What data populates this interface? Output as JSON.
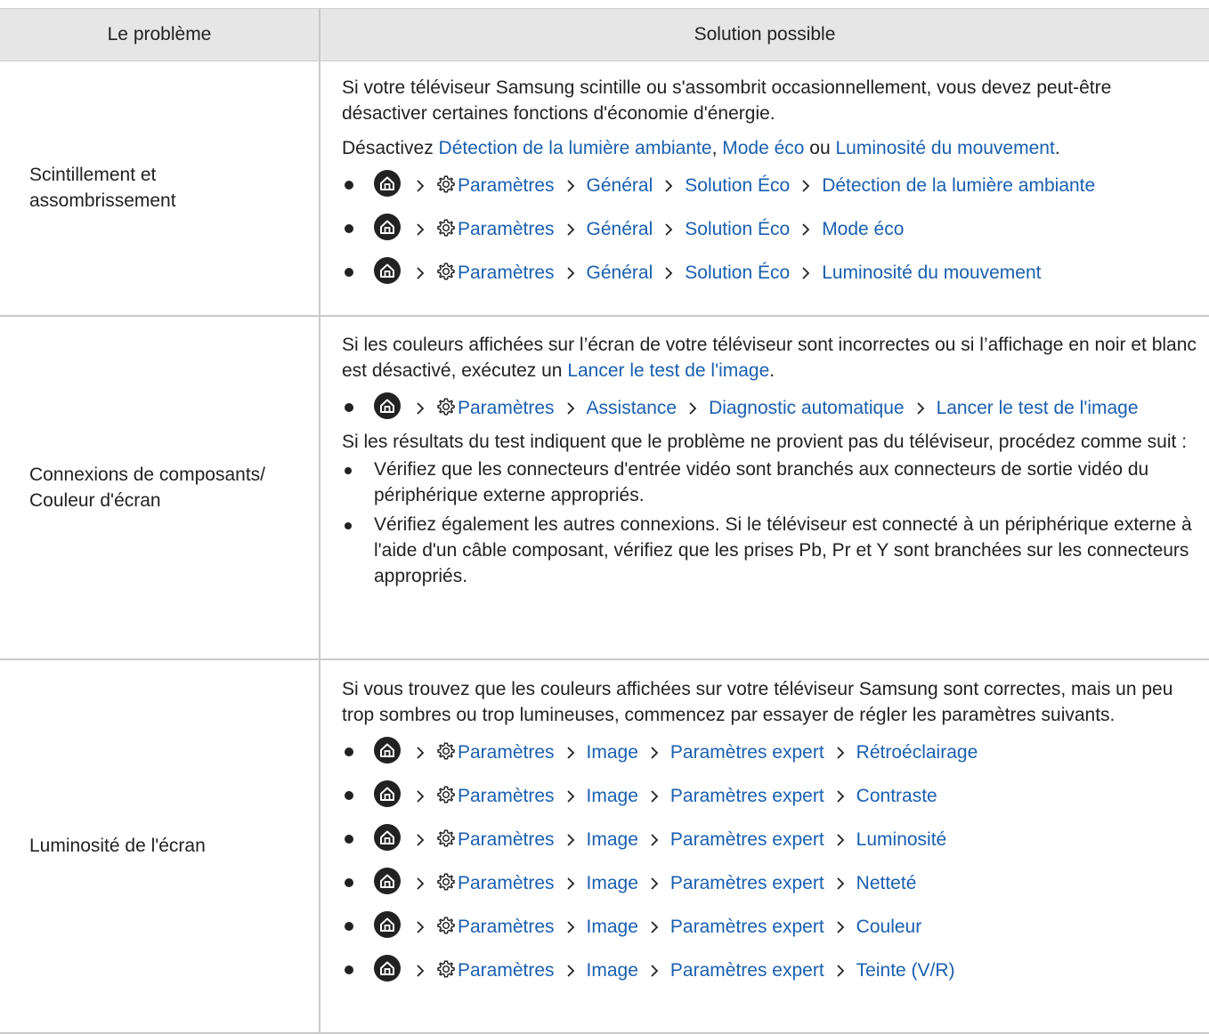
{
  "headers": {
    "col1": "Le problème",
    "col2": "Solution possible"
  },
  "rows": [
    {
      "problem": "Scintillement et assombrissement",
      "intro": "Si votre téléviseur Samsung scintille ou s'assombrit occasionnellement, vous devez peut-être désactiver certaines fonctions d'économie d'énergie.",
      "line2": {
        "pre": "Désactivez ",
        "l1": "Détection de la lumière ambiante",
        "s1": ", ",
        "l2": "Mode éco",
        "s2": " ou ",
        "l3": "Luminosité du mouvement",
        "end": "."
      },
      "paths": [
        {
          "a": "Paramètres",
          "b": "Général",
          "c": "Solution Éco",
          "d": "Détection de la lumière ambiante"
        },
        {
          "a": "Paramètres",
          "b": "Général",
          "c": "Solution Éco",
          "d": "Mode éco"
        },
        {
          "a": "Paramètres",
          "b": "Général",
          "c": "Solution Éco",
          "d": "Luminosité du mouvement"
        }
      ]
    },
    {
      "problem_l1": "Connexions de composants/",
      "problem_l2": "Couleur d'écran",
      "intro_pre": "Si les couleurs affichées sur l’écran de votre téléviseur sont incorrectes ou si l’affichage en noir et blanc est désactivé, exécutez un ",
      "intro_link": "Lancer le test de l'image",
      "intro_end": ".",
      "path": {
        "a": "Paramètres",
        "b": "Assistance",
        "c": "Diagnostic automatique",
        "d": "Lancer le test de l'image"
      },
      "para2": "Si les résultats du test indiquent que le problème ne provient pas du téléviseur, procédez comme suit :",
      "bullets": [
        "Vérifiez que les connecteurs d'entrée vidéo sont branchés aux connecteurs de sortie vidéo du périphérique externe appropriés.",
        "Vérifiez également les autres connexions. Si le téléviseur est connecté à un périphérique externe à l'aide d'un câble composant, vérifiez que les prises Pb, Pr et Y sont branchées sur les connecteurs appropriés."
      ]
    },
    {
      "problem": "Luminosité de l'écran",
      "intro": "Si vous trouvez que les couleurs affichées sur votre téléviseur Samsung sont correctes, mais un peu trop sombres ou trop lumineuses, commencez par essayer de régler les paramètres suivants.",
      "paths": [
        {
          "a": "Paramètres",
          "b": "Image",
          "c": "Paramètres expert",
          "d": "Rétroéclairage"
        },
        {
          "a": "Paramètres",
          "b": "Image",
          "c": "Paramètres expert",
          "d": "Contraste"
        },
        {
          "a": "Paramètres",
          "b": "Image",
          "c": "Paramètres expert",
          "d": "Luminosité"
        },
        {
          "a": "Paramètres",
          "b": "Image",
          "c": "Paramètres expert",
          "d": "Netteté"
        },
        {
          "a": "Paramètres",
          "b": "Image",
          "c": "Paramètres expert",
          "d": "Couleur"
        },
        {
          "a": "Paramètres",
          "b": "Image",
          "c": "Paramètres expert",
          "d": "Teinte (V/R)"
        }
      ]
    }
  ]
}
